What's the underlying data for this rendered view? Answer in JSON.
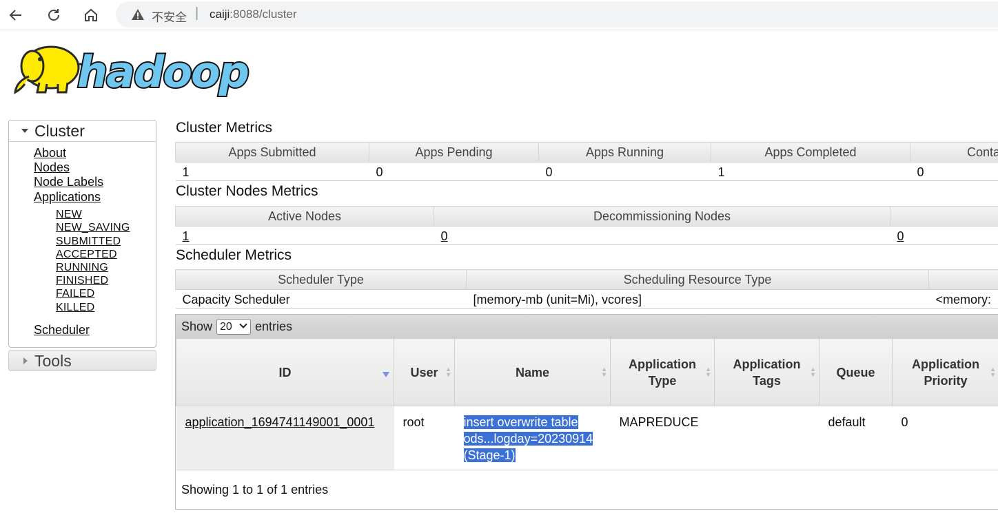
{
  "browser": {
    "security_label": "不安全",
    "url_host": "caiji",
    "url_rest": ":8088/cluster"
  },
  "logo": {
    "text": "hadoop"
  },
  "sidebar": {
    "cluster_title": "Cluster",
    "links": [
      "About",
      "Nodes",
      "Node Labels",
      "Applications"
    ],
    "app_states": [
      "NEW",
      "NEW_SAVING",
      "SUBMITTED",
      "ACCEPTED",
      "RUNNING",
      "FINISHED",
      "FAILED",
      "KILLED"
    ],
    "scheduler_link": "Scheduler",
    "tools_title": "Tools"
  },
  "cluster_metrics": {
    "title": "Cluster Metrics",
    "headers": [
      "Apps Submitted",
      "Apps Pending",
      "Apps Running",
      "Apps Completed",
      "Conta"
    ],
    "values": [
      "1",
      "0",
      "0",
      "1",
      "0"
    ]
  },
  "node_metrics": {
    "title": "Cluster Nodes Metrics",
    "headers": [
      "Active Nodes",
      "Decommissioning Nodes",
      ""
    ],
    "values": [
      "1",
      "0",
      "0"
    ]
  },
  "scheduler_metrics": {
    "title": "Scheduler Metrics",
    "headers": [
      "Scheduler Type",
      "Scheduling Resource Type",
      ""
    ],
    "values": [
      "Capacity Scheduler",
      "[memory-mb (unit=Mi), vcores]",
      "<memory:"
    ]
  },
  "apps": {
    "show_label": "Show",
    "page_size": "20",
    "entries_label": "entries",
    "columns": [
      "ID",
      "User",
      "Name",
      "Application Type",
      "Application Tags",
      "Queue",
      "Application Priority"
    ],
    "rows": [
      {
        "id": "application_1694741149001_0001",
        "user": "root",
        "name_lines": [
          "insert overwrite table",
          "ods...logday=20230914",
          "(Stage-1)"
        ],
        "type": "MAPREDUCE",
        "tags": "",
        "queue": "default",
        "priority": "0"
      }
    ],
    "footer": "Showing 1 to 1 of 1 entries"
  }
}
